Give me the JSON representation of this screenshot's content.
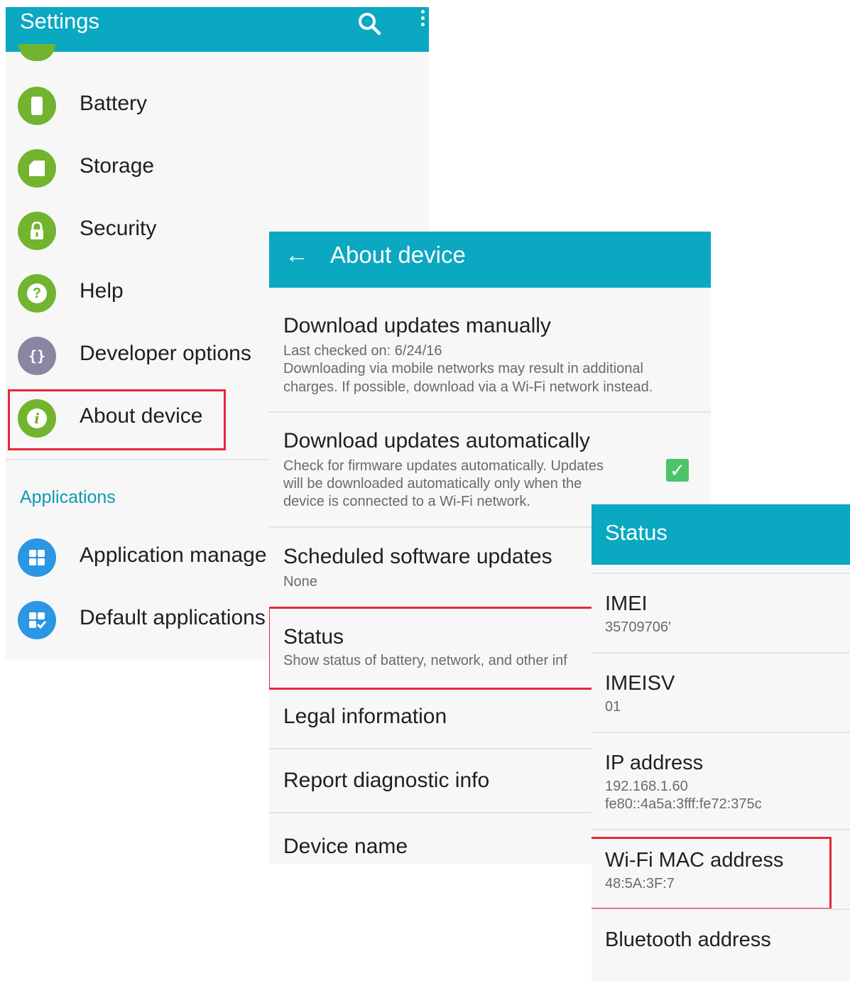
{
  "settings": {
    "title": "Settings",
    "items": [
      {
        "label": "Battery",
        "icon": "battery-icon"
      },
      {
        "label": "Storage",
        "icon": "sd-card-icon"
      },
      {
        "label": "Security",
        "icon": "lock-icon",
        "glyph": "🔒"
      },
      {
        "label": "Help",
        "icon": "question-icon",
        "glyph": "?"
      },
      {
        "label": "Developer options",
        "icon": "braces-icon",
        "glyph": "{}"
      },
      {
        "label": "About device",
        "icon": "info-icon",
        "glyph": "i"
      }
    ],
    "section_header": "Applications",
    "app_items": [
      {
        "label": "Application manage",
        "icon": "grid-icon"
      },
      {
        "label": "Default applications",
        "icon": "grid-check-icon"
      }
    ]
  },
  "about": {
    "title": "About device",
    "items": [
      {
        "title": "Download updates manually",
        "lines": [
          "Last checked on: 6/24/16",
          "Downloading via mobile networks may result in additional",
          "charges. If possible, download via a Wi-Fi network instead."
        ]
      },
      {
        "title": "Download updates automatically",
        "lines": [
          "Check for firmware updates automatically. Updates",
          "will be downloaded automatically only when the",
          "device is connected to a Wi-Fi network."
        ],
        "checked": true
      },
      {
        "title": "Scheduled software updates",
        "lines": [
          "None"
        ]
      },
      {
        "title": "Status",
        "lines": [
          "Show status of battery, network, and other inf"
        ]
      },
      {
        "title": "Legal information"
      },
      {
        "title": "Report diagnostic info"
      },
      {
        "title": "Device name"
      }
    ]
  },
  "status": {
    "title": "Status",
    "items": [
      {
        "title": "IMEI",
        "lines": [
          "35709706'"
        ]
      },
      {
        "title": "IMEISV",
        "lines": [
          "01"
        ]
      },
      {
        "title": "IP address",
        "lines": [
          "192.168.1.60",
          "fe80::4a5a:3fff:fe72:375c"
        ]
      },
      {
        "title": "Wi-Fi MAC address",
        "lines": [
          "48:5A:3F:7"
        ]
      },
      {
        "title": "Bluetooth address"
      }
    ]
  },
  "colors": {
    "accent": "#0aa8c1",
    "highlight": "#e5283a",
    "icon_green": "#72b42e",
    "icon_blue": "#2a96e4",
    "icon_purple": "#8a85a3",
    "check_green": "#4cc368"
  }
}
